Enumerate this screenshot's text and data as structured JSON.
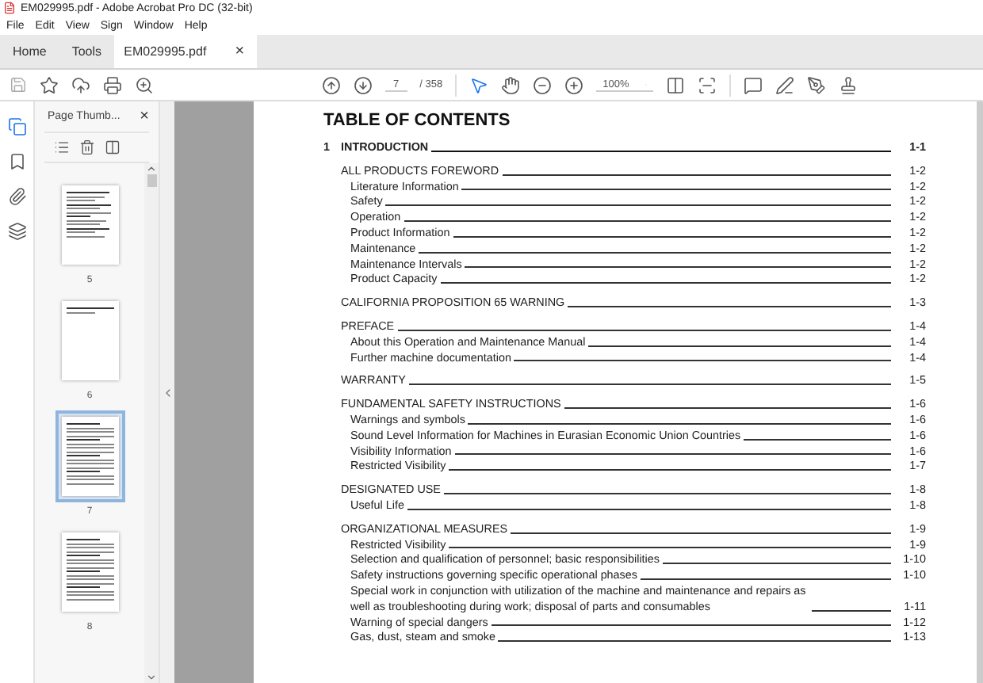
{
  "title_bar": {
    "title": "EM029995.pdf - Adobe Acrobat Pro DC (32-bit)"
  },
  "menu": [
    "File",
    "Edit",
    "View",
    "Sign",
    "Window",
    "Help"
  ],
  "tabs": [
    {
      "label": "Home",
      "selected": false
    },
    {
      "label": "Tools",
      "selected": false
    },
    {
      "label": "EM029995.pdf",
      "selected": true,
      "close": "×"
    }
  ],
  "toolbar": {
    "page_number": "7",
    "page_total": "/ 358",
    "zoom": "100%"
  },
  "thumbnails_panel": {
    "title": "Page Thumb...",
    "close": "×",
    "pages": [
      {
        "label": "5",
        "selected": false,
        "kind": "form"
      },
      {
        "label": "6",
        "selected": false,
        "kind": "blank"
      },
      {
        "label": "7",
        "selected": true,
        "kind": "toc"
      },
      {
        "label": "8",
        "selected": false,
        "kind": "toc"
      }
    ]
  },
  "document": {
    "heading": "TABLE OF CONTENTS",
    "chapter": {
      "number": "1",
      "title": "INTRODUCTION",
      "page": "1-1"
    },
    "sections": [
      {
        "title": "ALL PRODUCTS FOREWORD",
        "page": "1-2",
        "children": [
          {
            "title": "Literature Information",
            "page": "1-2"
          },
          {
            "title": "Safety",
            "page": "1-2"
          },
          {
            "title": "Operation",
            "page": "1-2"
          },
          {
            "title": "Product Information",
            "page": "1-2"
          },
          {
            "title": "Maintenance",
            "page": "1-2"
          },
          {
            "title": "Maintenance Intervals",
            "page": "1-2"
          },
          {
            "title": "Product Capacity",
            "page": "1-2"
          }
        ]
      },
      {
        "title": "CALIFORNIA PROPOSITION 65 WARNING",
        "page": "1-3"
      },
      {
        "title": "PREFACE",
        "page": "1-4",
        "children": [
          {
            "title": "About this Operation and Maintenance Manual",
            "page": "1-4"
          },
          {
            "title": "Further machine documentation",
            "page": "1-4"
          }
        ]
      },
      {
        "title": "WARRANTY",
        "page": "1-5"
      },
      {
        "title": "FUNDAMENTAL SAFETY INSTRUCTIONS",
        "page": "1-6",
        "children": [
          {
            "title": "Warnings and symbols",
            "page": "1-6"
          },
          {
            "title": "Sound Level Information for Machines in Eurasian Economic Union Countries",
            "page": "1-6"
          },
          {
            "title": "Visibility Information",
            "page": "1-6"
          },
          {
            "title": "Restricted Visibility",
            "page": "1-7"
          }
        ]
      },
      {
        "title": "DESIGNATED USE",
        "page": "1-8",
        "children": [
          {
            "title": "Useful Life",
            "page": "1-8"
          }
        ]
      },
      {
        "title": "ORGANIZATIONAL MEASURES",
        "page": "1-9",
        "children": [
          {
            "title": "Restricted Visibility",
            "page": "1-9"
          },
          {
            "title": "Selection and qualification of personnel; basic responsibilities",
            "page": "1-10"
          },
          {
            "title": "Safety instructions governing specific operational phases",
            "page": "1-10"
          },
          {
            "title": "Special work in conjunction with utilization of the machine and maintenance and repairs as well as troubleshooting during work; disposal of parts and consumables",
            "page": "1-11"
          },
          {
            "title": "Warning of special dangers",
            "page": "1-12"
          },
          {
            "title": "Gas, dust, steam and smoke",
            "page": "1-13"
          }
        ]
      }
    ]
  }
}
